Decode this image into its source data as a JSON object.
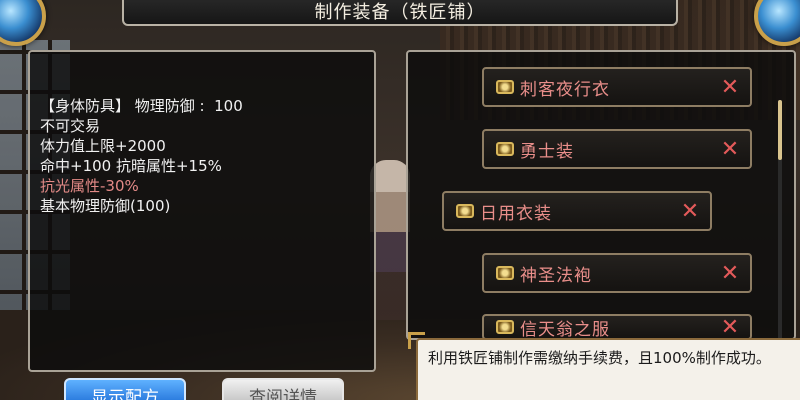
{
  "title": "制作装备（铁匠铺）",
  "info": {
    "lines": [
      "【身体防具】 物理防御 :  100",
      "不可交易",
      "体力值上限+2000",
      "命中+100 抗暗属性+15%",
      "抗光属性-30%",
      "基本物理防御(100)"
    ]
  },
  "items": [
    {
      "label": "刺客夜行衣",
      "remove": "✕"
    },
    {
      "label": "勇士装",
      "remove": "✕"
    },
    {
      "label": "日用衣装",
      "remove": "✕"
    },
    {
      "label": "神圣法袍",
      "remove": "✕"
    },
    {
      "label": "信天翁之服",
      "remove": "✕"
    }
  ],
  "hint": "利用铁匠铺制作需缴纳手续费，且100%制作成功。",
  "buttons": {
    "show_recipe": "显示配方",
    "view_details": "查阅详情"
  },
  "scroll": {
    "position": 0.0
  },
  "colors": {
    "item_text": "#e98e8a",
    "warning_text": "#e38a87",
    "primary_button": "#1e6ed6"
  },
  "icons": {
    "item": "scroll-icon",
    "remove": "close-icon"
  }
}
